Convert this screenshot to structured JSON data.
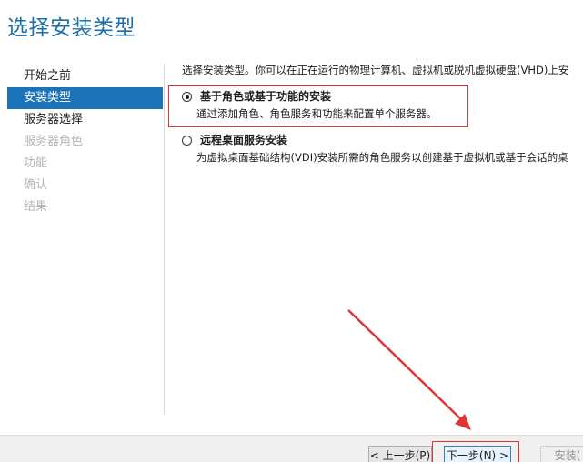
{
  "page": {
    "title": "选择安装类型"
  },
  "sidebar": {
    "items": [
      {
        "label": "开始之前",
        "state": "normal"
      },
      {
        "label": "安装类型",
        "state": "active"
      },
      {
        "label": "服务器选择",
        "state": "normal"
      },
      {
        "label": "服务器角色",
        "state": "disabled"
      },
      {
        "label": "功能",
        "state": "disabled"
      },
      {
        "label": "确认",
        "state": "disabled"
      },
      {
        "label": "结果",
        "state": "disabled"
      }
    ]
  },
  "main": {
    "description": "选择安装类型。你可以在正在运行的物理计算机、虚拟机或脱机虚拟硬盘(VHD)上安",
    "options": [
      {
        "title": "基于角色或基于功能的安装",
        "description": "通过添加角色、角色服务和功能来配置单个服务器。",
        "selected": true
      },
      {
        "title": "远程桌面服务安装",
        "description": "为虚拟桌面基础结构(VDI)安装所需的角色服务以创建基于虚拟机或基于会话的桌",
        "selected": false
      }
    ]
  },
  "footer": {
    "prev_label": "< 上一步(P)",
    "next_label": "下一步(N) >",
    "install_label": "安装("
  },
  "annotation": {
    "highlight_color": "#e03434"
  }
}
